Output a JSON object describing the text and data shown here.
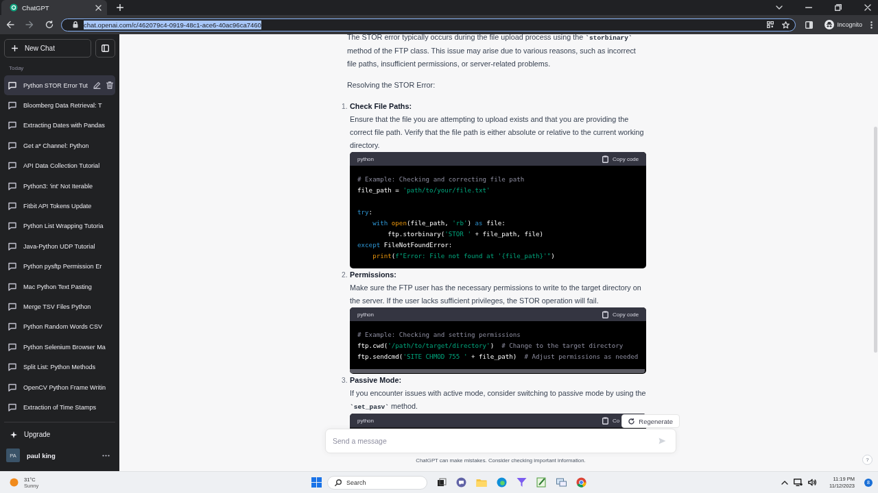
{
  "browser": {
    "tab_title": "ChatGPT",
    "url": "chat.openai.com/c/462079c4-0919-48c1-ace6-40ac96ca7460",
    "url_selected": true,
    "profile": "Incognito"
  },
  "sidebar": {
    "new_chat": "New Chat",
    "section": "Today",
    "chats": [
      {
        "title": "Python STOR Error Tut",
        "selected": true
      },
      {
        "title": "Bloomberg Data Retrieval: T",
        "selected": false
      },
      {
        "title": "Extracting Dates with Pandas",
        "selected": false
      },
      {
        "title": "Get a* Channel: Python",
        "selected": false
      },
      {
        "title": "API Data Collection Tutorial",
        "selected": false
      },
      {
        "title": "Python3: 'int' Not Iterable",
        "selected": false
      },
      {
        "title": "Fitbit API Tokens Update",
        "selected": false
      },
      {
        "title": "Python List Wrapping Tutoria",
        "selected": false
      },
      {
        "title": "Java-Python UDP Tutorial",
        "selected": false
      },
      {
        "title": "Python pysftp Permission Er",
        "selected": false
      },
      {
        "title": "Mac Python Text Pasting",
        "selected": false
      },
      {
        "title": "Merge TSV Files Python",
        "selected": false
      },
      {
        "title": "Python Random Words CSV",
        "selected": false
      },
      {
        "title": "Python Selenium Browser Ma",
        "selected": false
      },
      {
        "title": "Split List: Python Methods",
        "selected": false
      },
      {
        "title": "OpenCV Python Frame Writin",
        "selected": false
      },
      {
        "title": "Extraction of Time Stamps",
        "selected": false
      }
    ],
    "upgrade": "Upgrade",
    "user": {
      "initials": "PA",
      "name": "paul king"
    }
  },
  "conversation": {
    "paragraphs": [
      [
        {
          "kind": "text",
          "text": "The STOR error typically occurs during the file upload process using the "
        },
        {
          "kind": "code",
          "text": "`storbinary`"
        },
        {
          "kind": "text",
          "text": " method of the FTP class. This issue may arise due to various reasons, such as incorrect file paths, insufficient permissions, or server-related problems."
        }
      ],
      [
        {
          "kind": "text",
          "text": "Resolving the STOR Error:"
        }
      ]
    ],
    "steps": [
      {
        "number": "1.",
        "title": "Check File Paths:",
        "text": [
          {
            "kind": "text",
            "text": "Ensure that the file you are attempting to upload exists and that you are providing the correct file path. Verify that the file path is either absolute or relative to the current working directory."
          }
        ],
        "code": {
          "language": "python",
          "copy": "Copy code",
          "scrollbar": false,
          "lines": [
            {
              "kind": "code",
              "tokens": [
                {
                  "kind": "comment",
                  "text": "# Example: Checking and correcting file path"
                }
              ]
            },
            {
              "kind": "code",
              "tokens": [
                {
                  "kind": "plain",
                  "text": "file_path = "
                },
                {
                  "kind": "string",
                  "text": "'path/to/your/file.txt'"
                }
              ]
            },
            {
              "kind": "blank"
            },
            {
              "kind": "code",
              "tokens": [
                {
                  "kind": "keyword",
                  "text": "try"
                },
                {
                  "kind": "plain",
                  "text": ":"
                }
              ]
            },
            {
              "kind": "code",
              "tokens": [
                {
                  "kind": "keyword",
                  "text": "    with "
                },
                {
                  "kind": "builtin",
                  "text": "open"
                },
                {
                  "kind": "plain",
                  "text": "(file_path, "
                },
                {
                  "kind": "string",
                  "text": "'rb'"
                },
                {
                  "kind": "plain",
                  "text": ") "
                },
                {
                  "kind": "keyword",
                  "text": "as"
                },
                {
                  "kind": "plain",
                  "text": " file:"
                }
              ]
            },
            {
              "kind": "code",
              "tokens": [
                {
                  "kind": "plain",
                  "text": "        ftp.storbinary("
                },
                {
                  "kind": "string",
                  "text": "'STOR '"
                },
                {
                  "kind": "plain",
                  "text": " + file_path, file)"
                }
              ]
            },
            {
              "kind": "code",
              "tokens": [
                {
                  "kind": "keyword",
                  "text": "except"
                },
                {
                  "kind": "plain",
                  "text": " FileNotFoundError:"
                }
              ]
            },
            {
              "kind": "code",
              "tokens": [
                {
                  "kind": "builtin",
                  "text": "    print"
                },
                {
                  "kind": "plain",
                  "text": "("
                },
                {
                  "kind": "string",
                  "text": "f\"Error: File not found at '{file_path}'\""
                },
                {
                  "kind": "plain",
                  "text": ")"
                }
              ]
            }
          ]
        }
      },
      {
        "number": "2.",
        "title": "Permissions:",
        "text": [
          {
            "kind": "text",
            "text": "Make sure the FTP user has the necessary permissions to write to the target directory on the server. If the user lacks sufficient privileges, the STOR operation will fail."
          }
        ],
        "code": {
          "language": "python",
          "copy": "Copy code",
          "scrollbar": true,
          "lines": [
            {
              "kind": "code",
              "tokens": [
                {
                  "kind": "comment",
                  "text": "# Example: Checking and setting permissions"
                }
              ]
            },
            {
              "kind": "code",
              "tokens": [
                {
                  "kind": "plain",
                  "text": "ftp.cwd("
                },
                {
                  "kind": "string",
                  "text": "'/path/to/target/directory'"
                },
                {
                  "kind": "plain",
                  "text": ")  "
                },
                {
                  "kind": "comment",
                  "text": "# Change to the target directory"
                }
              ]
            },
            {
              "kind": "code",
              "tokens": [
                {
                  "kind": "plain",
                  "text": "ftp.sendcmd("
                },
                {
                  "kind": "string",
                  "text": "'SITE CHMOD 755 '"
                },
                {
                  "kind": "plain",
                  "text": " + file_path)  "
                },
                {
                  "kind": "comment",
                  "text": "# Adjust permissions as needed"
                }
              ]
            }
          ]
        }
      },
      {
        "number": "3.",
        "title": "Passive Mode:",
        "text": [
          {
            "kind": "text",
            "text": "If you encounter issues with active mode, consider switching to passive mode by using the "
          },
          {
            "kind": "code",
            "text": "`set_pasv`"
          },
          {
            "kind": "text",
            "text": " method."
          }
        ],
        "code": {
          "language": "python",
          "copy": "Co",
          "scrollbar": false
        }
      }
    ]
  },
  "composer": {
    "regenerate": "Regenerate",
    "placeholder": "Send a message",
    "disclaimer": "ChatGPT can make mistakes. Consider checking important information.",
    "help": "?"
  },
  "taskbar": {
    "weather": {
      "temperature": "31°C",
      "condition": "Sunny"
    },
    "search_placeholder": "Search",
    "time": "11:19 PM",
    "date": "11/12/2023",
    "notifications": "8"
  }
}
